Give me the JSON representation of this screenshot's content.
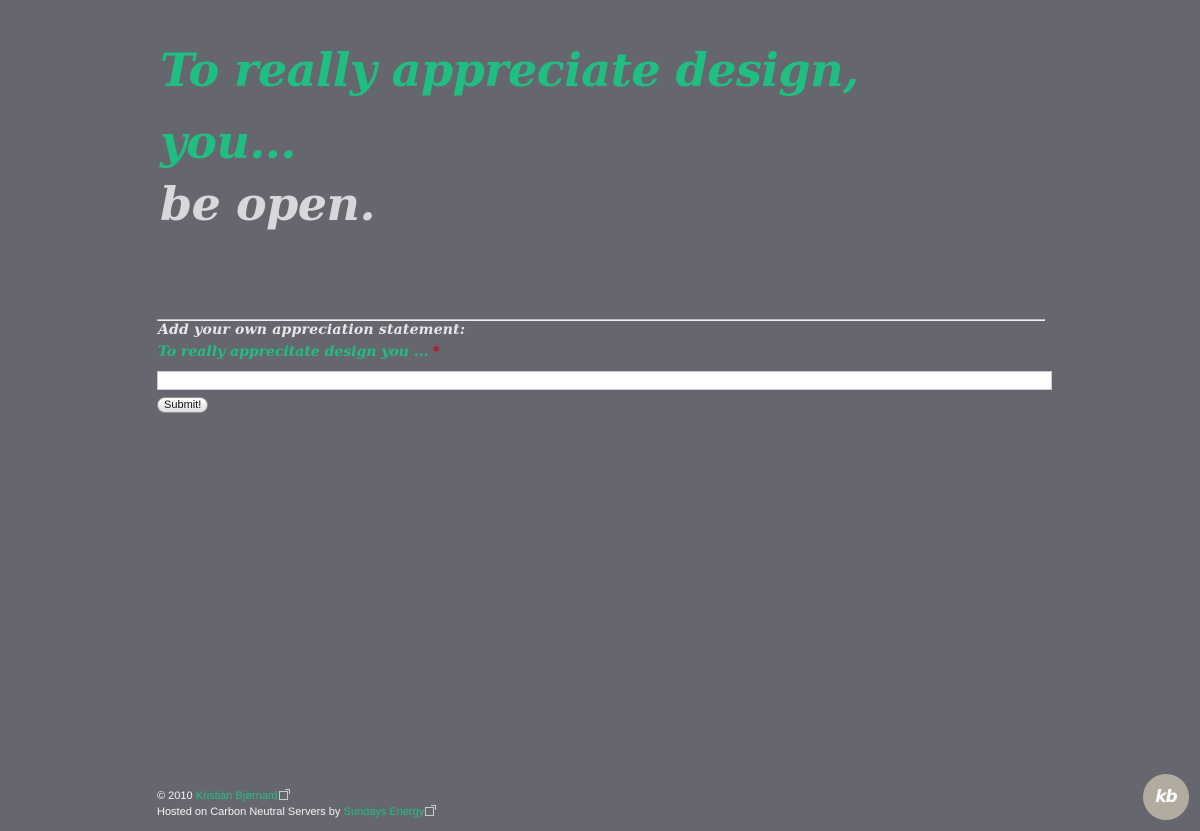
{
  "headline": {
    "line1": "To really appreciate design,",
    "line2": "you...",
    "line3": "be open."
  },
  "form": {
    "title": "Add your own appreciation statement:",
    "field_label": "To really apprecitate design you ...",
    "required_mark": "*",
    "input_value": "",
    "submit_label": "Submit!"
  },
  "footer": {
    "copyright": "© 2010",
    "author_link": "Kristian Bjørnard",
    "hosted_text": "Hosted on Carbon Neutral Servers by",
    "host_link": "Sundays Energy"
  },
  "logo": {
    "text": "kb"
  },
  "colors": {
    "background": "#66666f",
    "accent_green": "#1fbf84",
    "headline_grey": "#d6d8dc",
    "required_red": "#d0021b",
    "logo_bg": "#b1ac9f"
  },
  "icons": {
    "external_link": "external-link-icon"
  }
}
